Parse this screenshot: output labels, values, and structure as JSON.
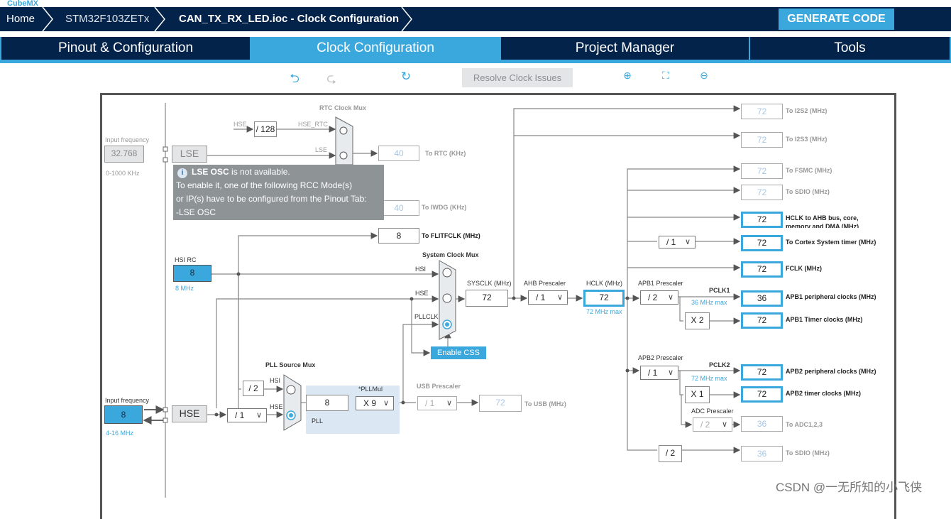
{
  "app": {
    "logo": "CubeMX"
  },
  "breadcrumb": [
    "Home",
    "STM32F103ZETx",
    "CAN_TX_RX_LED.ioc - Clock Configuration"
  ],
  "generate_label": "GENERATE CODE",
  "tabs": [
    {
      "label": "Pinout & Configuration",
      "active": false
    },
    {
      "label": "Clock Configuration",
      "active": true
    },
    {
      "label": "Project Manager",
      "active": false
    },
    {
      "label": "Tools",
      "active": false
    }
  ],
  "toolbar": {
    "undo": "undo-icon",
    "redo": "redo-icon",
    "refresh": "refresh-icon",
    "resolve_label": "Resolve Clock Issues",
    "zoom_in": "zoom-in-icon",
    "fit": "fit-icon",
    "zoom_out": "zoom-out-icon"
  },
  "lse": {
    "input_label": "Input frequency",
    "value": "32.768",
    "range": "0-1000 KHz",
    "name": "LSE"
  },
  "rtc": {
    "title": "RTC Clock Mux",
    "hse_label": "HSE",
    "div": "/ 128",
    "hse_rtc": "HSE_RTC",
    "lse_label": "LSE",
    "out_value": "40",
    "out_label": "To RTC (KHz)"
  },
  "tooltip": {
    "bold": "LSE OSC",
    "line1": " is not available.",
    "line2": "To enable it, one of the following RCC Mode(s)",
    "line3": "or IP(s) have to be configured from the Pinout Tab:",
    "line4": "-LSE OSC"
  },
  "iwdg": {
    "value": "40",
    "label": "To IWDG (KHz)"
  },
  "flit": {
    "value": "8",
    "label": "To FLITFCLK (MHz)"
  },
  "hsi": {
    "label": "HSI RC",
    "value": "8",
    "unit": "8 MHz"
  },
  "sysmux": {
    "title": "System Clock Mux",
    "hsi": "HSI",
    "hse": "HSE",
    "pllclk": "PLLCLK",
    "selected": "PLLCLK"
  },
  "sysclk": {
    "label": "SYSCLK (MHz)",
    "value": "72"
  },
  "ahb": {
    "label": "AHB Prescaler",
    "value": "/ 1"
  },
  "hclk": {
    "label": "HCLK (MHz)",
    "value": "72",
    "max": "72 MHz max"
  },
  "css_label": "Enable CSS",
  "hse": {
    "input_label": "Input frequency",
    "value": "8",
    "range": "4-16 MHz",
    "name": "HSE",
    "div": "/ 1"
  },
  "pllmux": {
    "title": "PLL Source Mux",
    "div": "/ 2",
    "hsi": "HSI",
    "hse": "HSE",
    "selected": "HSE"
  },
  "pll": {
    "input": "8",
    "mul_label": "*PLLMul",
    "mul": "X 9",
    "name": "PLL"
  },
  "usb": {
    "label": "USB Prescaler",
    "div": "/ 1",
    "value": "72",
    "out": "To USB (MHz)"
  },
  "apb1": {
    "label": "APB1 Prescaler",
    "div": "/ 2",
    "pclk": "PCLK1",
    "max": "36 MHz max",
    "timer_mul": "X 2"
  },
  "apb2": {
    "label": "APB2 Prescaler",
    "div": "/ 1",
    "pclk": "PCLK2",
    "max": "72 MHz max",
    "timer_mul": "X 1"
  },
  "adc": {
    "label": "ADC Prescaler",
    "div": "/ 2"
  },
  "cortex_div": "/ 1",
  "sdio_div": "/ 2",
  "outputs": [
    {
      "value": "72",
      "label": "To I2S2 (MHz)"
    },
    {
      "value": "72",
      "label": "To I2S3 (MHz)"
    },
    {
      "value": "72",
      "label": "To FSMC (MHz)"
    },
    {
      "value": "72",
      "label": "To SDIO (MHz)"
    },
    {
      "value": "72",
      "label": "HCLK to AHB bus, core, memory and DMA (MHz)"
    },
    {
      "value": "72",
      "label": "To Cortex System timer (MHz)"
    },
    {
      "value": "72",
      "label": "FCLK (MHz)"
    },
    {
      "value": "36",
      "label": "APB1 peripheral clocks (MHz)"
    },
    {
      "value": "72",
      "label": "APB1 Timer clocks (MHz)"
    },
    {
      "value": "72",
      "label": "APB2 peripheral clocks (MHz)"
    },
    {
      "value": "72",
      "label": "APB2 timer clocks (MHz)"
    },
    {
      "value": "36",
      "label": "To ADC1,2,3"
    },
    {
      "value": "36",
      "label": "To SDIO (MHz)"
    }
  ],
  "watermark": "CSDN @一无所知的小飞侠",
  "colors": {
    "navy": "#03234b",
    "accent": "#3aa7dd",
    "pll_bg": "#dbe8f4",
    "tooltip": "#8e9396"
  }
}
